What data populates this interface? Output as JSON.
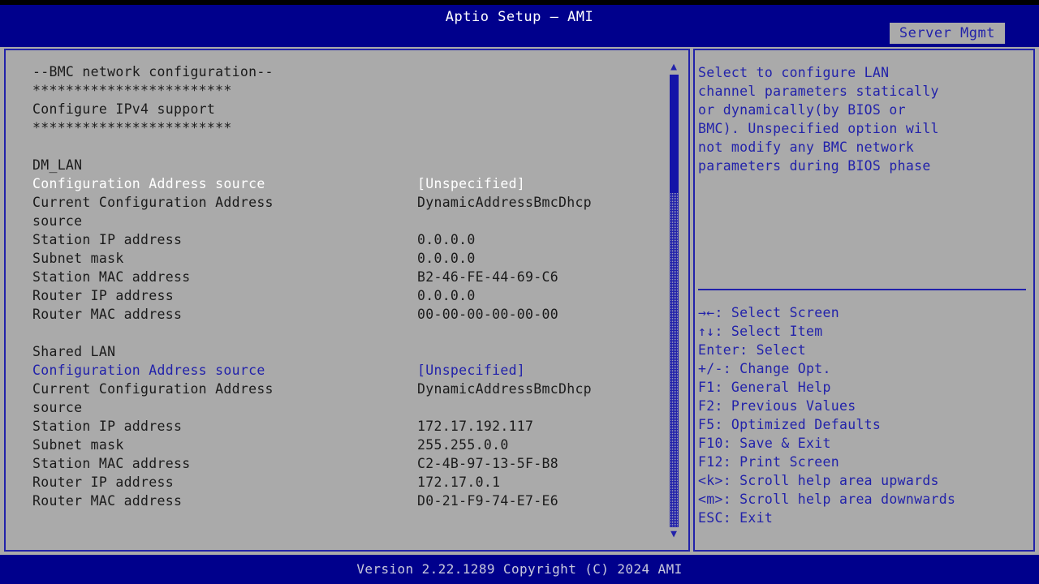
{
  "window": {
    "title": "Aptio Setup – AMI",
    "active_tab": "Server Mgmt"
  },
  "main": {
    "section_title": "--BMC network configuration--",
    "separator": "************************",
    "subsection_title": "Configure IPv4 support",
    "groups": [
      {
        "name": "DM_LAN",
        "rows": [
          {
            "label": "Configuration Address source",
            "value": "[Unspecified]",
            "style": "white"
          },
          {
            "label": "Current Configuration Address",
            "value": "DynamicAddressBmcDhcp",
            "style": "dark"
          },
          {
            "label": "source",
            "value": "",
            "style": "dark"
          },
          {
            "label": "Station IP address",
            "value": "0.0.0.0",
            "style": "dark"
          },
          {
            "label": "Subnet mask",
            "value": "0.0.0.0",
            "style": "dark"
          },
          {
            "label": "Station MAC address",
            "value": "B2-46-FE-44-69-C6",
            "style": "dark"
          },
          {
            "label": "Router IP address",
            "value": "0.0.0.0",
            "style": "dark"
          },
          {
            "label": "Router MAC address",
            "value": "00-00-00-00-00-00",
            "style": "dark"
          }
        ]
      },
      {
        "name": "Shared LAN",
        "rows": [
          {
            "label": "Configuration Address source",
            "value": "[Unspecified]",
            "style": "blue"
          },
          {
            "label": "Current Configuration Address",
            "value": "DynamicAddressBmcDhcp",
            "style": "dark"
          },
          {
            "label": "source",
            "value": "",
            "style": "dark"
          },
          {
            "label": "Station IP address",
            "value": "172.17.192.117",
            "style": "dark"
          },
          {
            "label": "Subnet mask",
            "value": "255.255.0.0",
            "style": "dark"
          },
          {
            "label": "Station MAC address",
            "value": "C2-4B-97-13-5F-B8",
            "style": "dark"
          },
          {
            "label": "Router IP address",
            "value": "172.17.0.1",
            "style": "dark"
          },
          {
            "label": "Router MAC address",
            "value": "D0-21-F9-74-E7-E6",
            "style": "dark"
          }
        ]
      }
    ],
    "scrollbar": {
      "up_arrow": "▲",
      "down_arrow": "▼"
    }
  },
  "help": {
    "lines": [
      "Select to configure LAN",
      "channel parameters statically",
      "or dynamically(by BIOS or",
      "BMC). Unspecified option will",
      "not modify any BMC network",
      "parameters during BIOS phase"
    ],
    "legend": [
      "→←: Select Screen",
      "↑↓: Select Item",
      "Enter: Select",
      "+/-: Change Opt.",
      "F1: General Help",
      "F2: Previous Values",
      "F5: Optimized Defaults",
      "F10: Save & Exit",
      "F12: Print Screen",
      "<k>: Scroll help area upwards",
      "<m>: Scroll help area downwards",
      "ESC: Exit"
    ]
  },
  "footer": {
    "version_text": "Version 2.22.1289 Copyright (C) 2024 AMI"
  },
  "colors": {
    "title_bar": "#00008c",
    "body": "#aaaaaa",
    "border": "#2222aa",
    "selected_text": "#2222aa",
    "highlight_text": "#ffffff"
  }
}
